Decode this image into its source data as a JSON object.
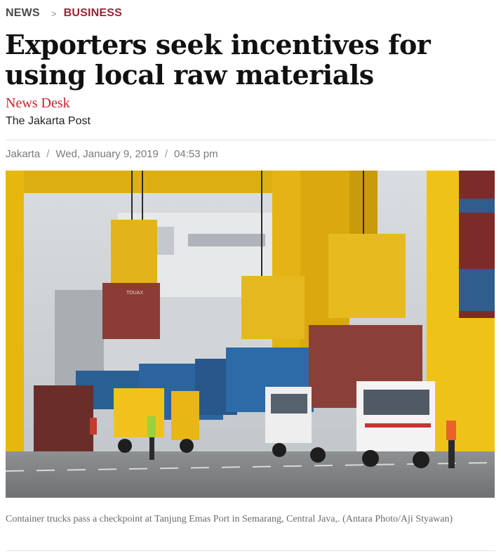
{
  "breadcrumb": {
    "section": "NEWS",
    "separator": ">",
    "subsection": "BUSINESS"
  },
  "article": {
    "headline": "Exporters seek incentives for using local raw materials",
    "author": "News Desk",
    "publisher": "The Jakarta Post",
    "location": "Jakarta",
    "date": "Wed, January 9, 2019",
    "time": "04:53 pm",
    "meta_separator": "/",
    "photo_caption": "Container trucks pass a checkpoint at Tanjung Emas Port in Semarang, Central Java,. (Antara Photo/Aji Styawan)",
    "container_brand_text": "TOUAX"
  },
  "colors": {
    "brand_red": "#9b2335",
    "author_red": "#cc2030",
    "meta_gray": "#7a7a7a",
    "crane_yellow": "#f0c419"
  }
}
